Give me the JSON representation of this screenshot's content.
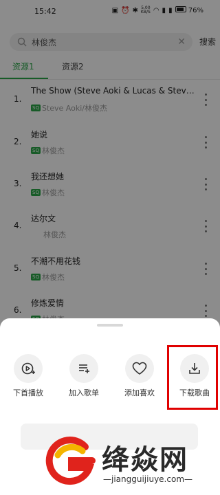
{
  "status_bar": {
    "time": "15:42",
    "net_speed_top": "5.00",
    "net_speed_bottom": "KB/S",
    "battery": "76%"
  },
  "search": {
    "query": "林俊杰",
    "button": "搜索"
  },
  "tabs": [
    {
      "label": "资源1",
      "active": true
    },
    {
      "label": "资源2",
      "active": false
    }
  ],
  "songs": [
    {
      "num": "1.",
      "title": "The Show (Steve Aoki & Lucas & Steve Re...",
      "artist": "Steve Aoki/林俊杰",
      "badge": "SQ"
    },
    {
      "num": "2.",
      "title": "她说",
      "artist": "林俊杰",
      "badge": "SQ"
    },
    {
      "num": "3.",
      "title": "我还想她",
      "artist": "林俊杰",
      "badge": "SQ"
    },
    {
      "num": "4.",
      "title": "达尔文",
      "artist": "林俊杰",
      "badge": ""
    },
    {
      "num": "5.",
      "title": "不潮不用花钱",
      "artist": "林俊杰",
      "badge": "SQ"
    },
    {
      "num": "6.",
      "title": "修炼爱情",
      "artist": "林俊杰",
      "badge": "SQ"
    }
  ],
  "sheet": {
    "actions": [
      {
        "label": "下首播放",
        "icon": "play-next-icon"
      },
      {
        "label": "加入歌单",
        "icon": "add-to-playlist-icon"
      },
      {
        "label": "添加喜欢",
        "icon": "heart-icon"
      },
      {
        "label": "下载歌曲",
        "icon": "download-icon"
      }
    ]
  },
  "watermark": {
    "name": "绛焱网",
    "url": "—jiangguijiuye.com—"
  },
  "colors": {
    "accent": "#2aa748",
    "highlight": "#e00000"
  }
}
